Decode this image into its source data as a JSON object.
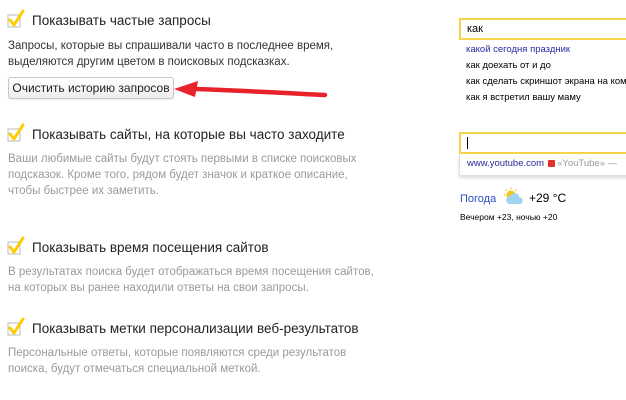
{
  "colors": {
    "accent_checkbox": "#ffcc00",
    "arrow": "#e8212b",
    "input_border": "#f7d347"
  },
  "options": [
    {
      "label": "Показывать частые запросы",
      "checked": true,
      "description_lines": [
        "Запросы, которые вы спрашивали часто в последнее время,",
        "выделяются другим цветом в поисковых подсказках."
      ],
      "button_label": "Очистить историю запросов"
    },
    {
      "label": "Показывать сайты, на которые вы часто заходите",
      "checked": true,
      "description_lines": [
        "Ваши любимые сайты будут стоять первыми в списке поисковых",
        "подсказок. Кроме того, рядом будет значок и краткое описание,",
        "чтобы быстрее их заметить."
      ]
    },
    {
      "label": "Показывать время посещения сайтов",
      "checked": true,
      "description_lines": [
        "В результатах поиска будет отображаться время посещения сайтов,",
        "на которых вы ранее находили ответы на свои запросы."
      ]
    },
    {
      "label": "Показывать метки персонализации веб-результатов",
      "checked": true,
      "description_lines": [
        "Персональные ответы, которые появляются среди результатов",
        "поиска, будут отмечаться специальной меткой."
      ]
    }
  ],
  "preview_frequent": {
    "query": "как",
    "suggestions": [
      {
        "prefix": "какой сегодня праздник",
        "rest": ""
      },
      {
        "prefix": "как",
        "rest": " доехать от и до"
      },
      {
        "prefix": "как",
        "rest": " сделать скриншот экрана на компь"
      },
      {
        "prefix": "как",
        "rest": " я встретил вашу маму"
      }
    ]
  },
  "preview_sites": {
    "site_url": "www.youtube.com",
    "site_title": "«YouTube» —",
    "weather_title": "Погода",
    "weather_icon": "partly-cloudy-icon",
    "weather_temp": "+29 °C",
    "weather_details": "Вечером +23,  ночью +20"
  }
}
